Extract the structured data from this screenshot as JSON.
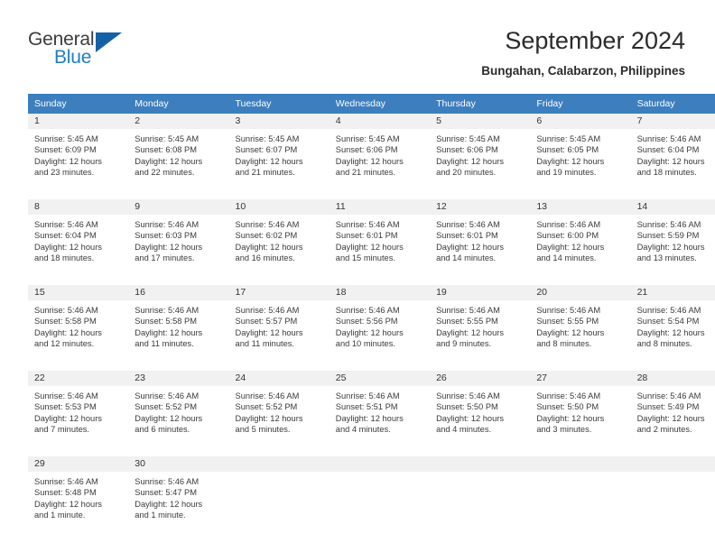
{
  "logo": {
    "word1": "General",
    "word2": "Blue",
    "triangle": "logo-triangle-icon",
    "colors": {
      "dark": "#3c3c3c",
      "blue": "#1f7ec4",
      "triangle": "#1461a8"
    }
  },
  "header": {
    "title": "September 2024",
    "subtitle": "Bungahan, Calabarzon, Philippines"
  },
  "theme": {
    "header_row_bg": "#3d7ebf",
    "daynum_bg": "#f1f1f1",
    "text": "#3a3a3a"
  },
  "weekdays": [
    "Sunday",
    "Monday",
    "Tuesday",
    "Wednesday",
    "Thursday",
    "Friday",
    "Saturday"
  ],
  "weeks": [
    [
      {
        "day": "1",
        "sunrise": "Sunrise: 5:45 AM",
        "sunset": "Sunset: 6:09 PM",
        "daylight1": "Daylight: 12 hours",
        "daylight2": "and 23 minutes."
      },
      {
        "day": "2",
        "sunrise": "Sunrise: 5:45 AM",
        "sunset": "Sunset: 6:08 PM",
        "daylight1": "Daylight: 12 hours",
        "daylight2": "and 22 minutes."
      },
      {
        "day": "3",
        "sunrise": "Sunrise: 5:45 AM",
        "sunset": "Sunset: 6:07 PM",
        "daylight1": "Daylight: 12 hours",
        "daylight2": "and 21 minutes."
      },
      {
        "day": "4",
        "sunrise": "Sunrise: 5:45 AM",
        "sunset": "Sunset: 6:06 PM",
        "daylight1": "Daylight: 12 hours",
        "daylight2": "and 21 minutes."
      },
      {
        "day": "5",
        "sunrise": "Sunrise: 5:45 AM",
        "sunset": "Sunset: 6:06 PM",
        "daylight1": "Daylight: 12 hours",
        "daylight2": "and 20 minutes."
      },
      {
        "day": "6",
        "sunrise": "Sunrise: 5:45 AM",
        "sunset": "Sunset: 6:05 PM",
        "daylight1": "Daylight: 12 hours",
        "daylight2": "and 19 minutes."
      },
      {
        "day": "7",
        "sunrise": "Sunrise: 5:46 AM",
        "sunset": "Sunset: 6:04 PM",
        "daylight1": "Daylight: 12 hours",
        "daylight2": "and 18 minutes."
      }
    ],
    [
      {
        "day": "8",
        "sunrise": "Sunrise: 5:46 AM",
        "sunset": "Sunset: 6:04 PM",
        "daylight1": "Daylight: 12 hours",
        "daylight2": "and 18 minutes."
      },
      {
        "day": "9",
        "sunrise": "Sunrise: 5:46 AM",
        "sunset": "Sunset: 6:03 PM",
        "daylight1": "Daylight: 12 hours",
        "daylight2": "and 17 minutes."
      },
      {
        "day": "10",
        "sunrise": "Sunrise: 5:46 AM",
        "sunset": "Sunset: 6:02 PM",
        "daylight1": "Daylight: 12 hours",
        "daylight2": "and 16 minutes."
      },
      {
        "day": "11",
        "sunrise": "Sunrise: 5:46 AM",
        "sunset": "Sunset: 6:01 PM",
        "daylight1": "Daylight: 12 hours",
        "daylight2": "and 15 minutes."
      },
      {
        "day": "12",
        "sunrise": "Sunrise: 5:46 AM",
        "sunset": "Sunset: 6:01 PM",
        "daylight1": "Daylight: 12 hours",
        "daylight2": "and 14 minutes."
      },
      {
        "day": "13",
        "sunrise": "Sunrise: 5:46 AM",
        "sunset": "Sunset: 6:00 PM",
        "daylight1": "Daylight: 12 hours",
        "daylight2": "and 14 minutes."
      },
      {
        "day": "14",
        "sunrise": "Sunrise: 5:46 AM",
        "sunset": "Sunset: 5:59 PM",
        "daylight1": "Daylight: 12 hours",
        "daylight2": "and 13 minutes."
      }
    ],
    [
      {
        "day": "15",
        "sunrise": "Sunrise: 5:46 AM",
        "sunset": "Sunset: 5:58 PM",
        "daylight1": "Daylight: 12 hours",
        "daylight2": "and 12 minutes."
      },
      {
        "day": "16",
        "sunrise": "Sunrise: 5:46 AM",
        "sunset": "Sunset: 5:58 PM",
        "daylight1": "Daylight: 12 hours",
        "daylight2": "and 11 minutes."
      },
      {
        "day": "17",
        "sunrise": "Sunrise: 5:46 AM",
        "sunset": "Sunset: 5:57 PM",
        "daylight1": "Daylight: 12 hours",
        "daylight2": "and 11 minutes."
      },
      {
        "day": "18",
        "sunrise": "Sunrise: 5:46 AM",
        "sunset": "Sunset: 5:56 PM",
        "daylight1": "Daylight: 12 hours",
        "daylight2": "and 10 minutes."
      },
      {
        "day": "19",
        "sunrise": "Sunrise: 5:46 AM",
        "sunset": "Sunset: 5:55 PM",
        "daylight1": "Daylight: 12 hours",
        "daylight2": "and 9 minutes."
      },
      {
        "day": "20",
        "sunrise": "Sunrise: 5:46 AM",
        "sunset": "Sunset: 5:55 PM",
        "daylight1": "Daylight: 12 hours",
        "daylight2": "and 8 minutes."
      },
      {
        "day": "21",
        "sunrise": "Sunrise: 5:46 AM",
        "sunset": "Sunset: 5:54 PM",
        "daylight1": "Daylight: 12 hours",
        "daylight2": "and 8 minutes."
      }
    ],
    [
      {
        "day": "22",
        "sunrise": "Sunrise: 5:46 AM",
        "sunset": "Sunset: 5:53 PM",
        "daylight1": "Daylight: 12 hours",
        "daylight2": "and 7 minutes."
      },
      {
        "day": "23",
        "sunrise": "Sunrise: 5:46 AM",
        "sunset": "Sunset: 5:52 PM",
        "daylight1": "Daylight: 12 hours",
        "daylight2": "and 6 minutes."
      },
      {
        "day": "24",
        "sunrise": "Sunrise: 5:46 AM",
        "sunset": "Sunset: 5:52 PM",
        "daylight1": "Daylight: 12 hours",
        "daylight2": "and 5 minutes."
      },
      {
        "day": "25",
        "sunrise": "Sunrise: 5:46 AM",
        "sunset": "Sunset: 5:51 PM",
        "daylight1": "Daylight: 12 hours",
        "daylight2": "and 4 minutes."
      },
      {
        "day": "26",
        "sunrise": "Sunrise: 5:46 AM",
        "sunset": "Sunset: 5:50 PM",
        "daylight1": "Daylight: 12 hours",
        "daylight2": "and 4 minutes."
      },
      {
        "day": "27",
        "sunrise": "Sunrise: 5:46 AM",
        "sunset": "Sunset: 5:50 PM",
        "daylight1": "Daylight: 12 hours",
        "daylight2": "and 3 minutes."
      },
      {
        "day": "28",
        "sunrise": "Sunrise: 5:46 AM",
        "sunset": "Sunset: 5:49 PM",
        "daylight1": "Daylight: 12 hours",
        "daylight2": "and 2 minutes."
      }
    ],
    [
      {
        "day": "29",
        "sunrise": "Sunrise: 5:46 AM",
        "sunset": "Sunset: 5:48 PM",
        "daylight1": "Daylight: 12 hours",
        "daylight2": "and 1 minute."
      },
      {
        "day": "30",
        "sunrise": "Sunrise: 5:46 AM",
        "sunset": "Sunset: 5:47 PM",
        "daylight1": "Daylight: 12 hours",
        "daylight2": "and 1 minute."
      },
      {
        "day": "",
        "sunrise": "",
        "sunset": "",
        "daylight1": "",
        "daylight2": ""
      },
      {
        "day": "",
        "sunrise": "",
        "sunset": "",
        "daylight1": "",
        "daylight2": ""
      },
      {
        "day": "",
        "sunrise": "",
        "sunset": "",
        "daylight1": "",
        "daylight2": ""
      },
      {
        "day": "",
        "sunrise": "",
        "sunset": "",
        "daylight1": "",
        "daylight2": ""
      },
      {
        "day": "",
        "sunrise": "",
        "sunset": "",
        "daylight1": "",
        "daylight2": ""
      }
    ]
  ]
}
